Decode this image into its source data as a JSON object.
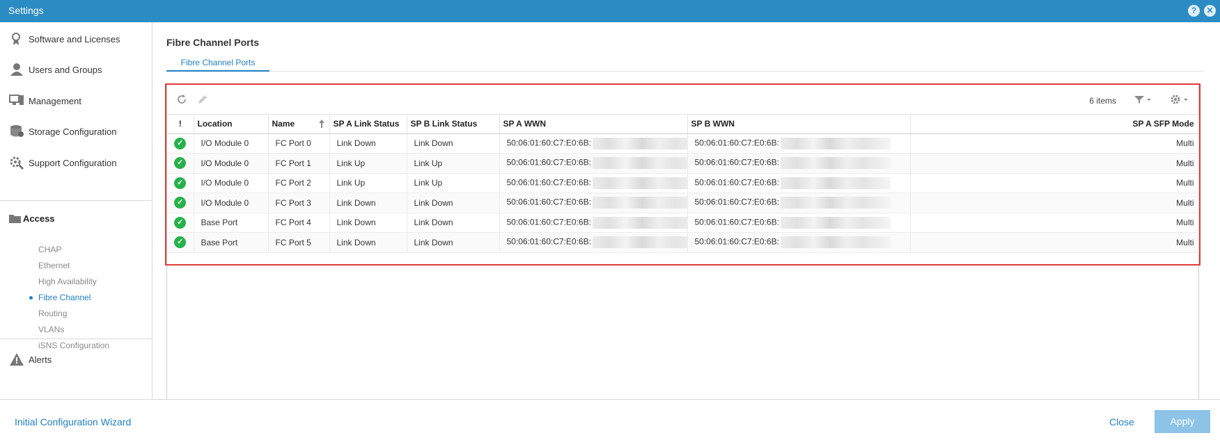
{
  "window": {
    "title": "Settings",
    "help_icon": "?",
    "close_icon": "✕"
  },
  "sidebar": {
    "items": [
      {
        "label": "Software and Licenses",
        "icon": "ribbon-icon"
      },
      {
        "label": "Users and Groups",
        "icon": "user-icon"
      },
      {
        "label": "Management",
        "icon": "monitor-icon"
      },
      {
        "label": "Storage Configuration",
        "icon": "database-icon"
      },
      {
        "label": "Support Configuration",
        "icon": "gear-icon"
      }
    ],
    "access": {
      "label": "Access",
      "icon": "folder-icon",
      "subitems": [
        "CHAP",
        "Ethernet",
        "High Availability",
        "Fibre Channel",
        "Routing",
        "VLANs",
        "iSNS Configuration"
      ],
      "active": "Fibre Channel"
    },
    "alerts": {
      "label": "Alerts",
      "icon": "warning-icon"
    }
  },
  "main": {
    "title": "Fibre Channel Ports",
    "tab": "Fibre Channel Ports",
    "item_count": "6 items",
    "columns": [
      "!",
      "Location",
      "Name",
      "SP A Link Status",
      "SP B Link Status",
      "SP A WWN",
      "SP B WWN",
      "SP A SFP Mode"
    ],
    "rows": [
      {
        "location": "I/O Module 0",
        "name": "FC Port 0",
        "spa_status": "Link Down",
        "spb_status": "Link Down",
        "spa_wwn": "50:06:01:60:C7:E0:6B:",
        "spb_wwn": "50:06:01:60:C7:E0:6B:",
        "sfp_mode": "Multi"
      },
      {
        "location": "I/O Module 0",
        "name": "FC Port 1",
        "spa_status": "Link Up",
        "spb_status": "Link Up",
        "spa_wwn": "50:06:01:60:C7:E0:6B:",
        "spb_wwn": "50:06:01:60:C7:E0:6B:",
        "sfp_mode": "Multi"
      },
      {
        "location": "I/O Module 0",
        "name": "FC Port 2",
        "spa_status": "Link Up",
        "spb_status": "Link Up",
        "spa_wwn": "50:06:01:60:C7:E0:6B:",
        "spb_wwn": "50:06:01:60:C7:E0:6B:",
        "sfp_mode": "Multi"
      },
      {
        "location": "I/O Module 0",
        "name": "FC Port 3",
        "spa_status": "Link Down",
        "spb_status": "Link Down",
        "spa_wwn": "50:06:01:60:C7:E0:6B:",
        "spb_wwn": "50:06:01:60:C7:E0:6B:",
        "sfp_mode": "Multi"
      },
      {
        "location": "Base Port",
        "name": "FC Port 4",
        "spa_status": "Link Down",
        "spb_status": "Link Down",
        "spa_wwn": "50:06:01:60:C7:E0:6B:",
        "spb_wwn": "50:06:01:60:C7:E0:6B:",
        "sfp_mode": "Multi"
      },
      {
        "location": "Base Port",
        "name": "FC Port 5",
        "spa_status": "Link Down",
        "spb_status": "Link Down",
        "spa_wwn": "50:06:01:60:C7:E0:6B:",
        "spb_wwn": "50:06:01:60:C7:E0:6B:",
        "sfp_mode": "Multi"
      }
    ]
  },
  "footer": {
    "wizard_link": "Initial Configuration Wizard",
    "close_label": "Close",
    "apply_label": "Apply"
  },
  "colors": {
    "accent": "#2b8cc4",
    "link": "#1f7fc1",
    "highlight_border": "#e03a3a",
    "status_ok": "#25b24a",
    "apply_disabled": "#8cc3e6"
  }
}
